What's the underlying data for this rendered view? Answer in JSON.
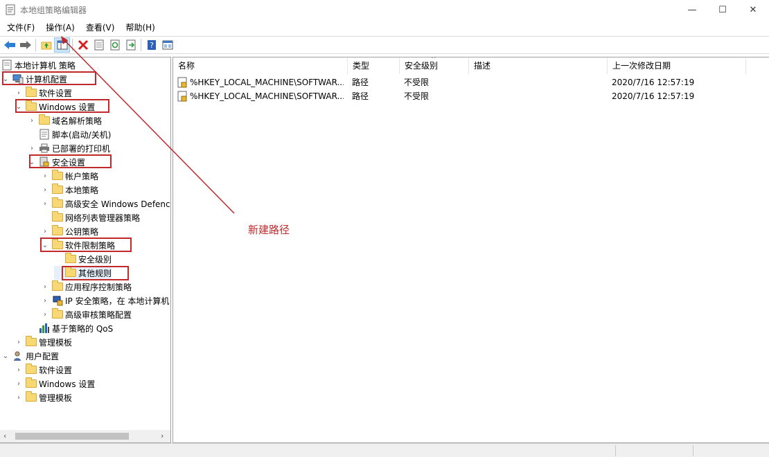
{
  "window": {
    "title": "本地组策略编辑器",
    "minimize": "—",
    "maximize": "☐",
    "close": "✕"
  },
  "menu": [
    "文件(F)",
    "操作(A)",
    "查看(V)",
    "帮助(H)"
  ],
  "toolbar": [
    "back-icon",
    "forward-icon",
    "up-folder-icon",
    "show-tree-icon",
    "delete-icon",
    "properties-icon",
    "refresh-icon",
    "export-icon",
    "help-icon",
    "view-icon"
  ],
  "tree": {
    "root": "本地计算机 策略",
    "computer_config": "计算机配置",
    "software_settings": "软件设置",
    "windows_settings": "Windows 设置",
    "dns_policy": "域名解析策略",
    "scripts": "脚本(启动/关机)",
    "printers": "已部署的打印机",
    "security_settings": "安全设置",
    "account_policy": "帐户策略",
    "local_policy": "本地策略",
    "defender_firewall": "高级安全 Windows Defenc",
    "network_list": "网络列表管理器策略",
    "public_key": "公钥策略",
    "srp": "软件限制策略",
    "security_levels": "安全级别",
    "other_rules": "其他规则",
    "app_control": "应用程序控制策略",
    "ipsec": "IP 安全策略，在 本地计算机",
    "audit": "高级审核策略配置",
    "qos": "基于策略的 QoS",
    "admin_templates": "管理模板",
    "user_config": "用户配置",
    "user_software": "软件设置",
    "user_windows": "Windows 设置",
    "user_admin": "管理模板"
  },
  "list": {
    "headers": [
      "名称",
      "类型",
      "安全级别",
      "描述",
      "上一次修改日期"
    ],
    "rows": [
      {
        "name": "%HKEY_LOCAL_MACHINE\\SOFTWAR...",
        "type": "路径",
        "level": "不受限",
        "desc": "",
        "date": "2020/7/16  12:57:19"
      },
      {
        "name": "%HKEY_LOCAL_MACHINE\\SOFTWAR...",
        "type": "路径",
        "level": "不受限",
        "desc": "",
        "date": "2020/7/16  12:57:19"
      }
    ]
  },
  "annotation": "新建路径",
  "colors": {
    "annotation": "#c0282a",
    "selection": "#cce4f7",
    "folder": "#f8d775"
  }
}
